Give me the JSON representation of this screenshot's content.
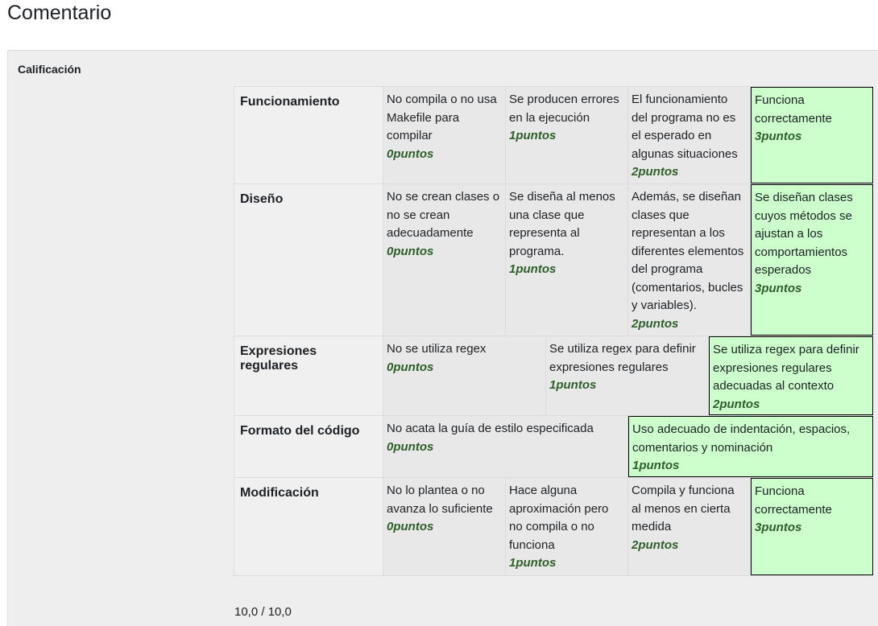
{
  "page": {
    "heading": "Comentario"
  },
  "grading": {
    "label": "Calificación",
    "total": "10,0 / 10,0"
  },
  "rubric": [
    {
      "criterion": "Funcionamiento",
      "height": 120,
      "levels": [
        {
          "definition": "No compila o no usa Makefile para compilar",
          "score": "0puntos",
          "checked": false
        },
        {
          "definition": "Se producen errores en la ejecución",
          "score": "1puntos",
          "checked": false
        },
        {
          "definition": "El funcionamiento del programa no es el esperado en algunas situaciones",
          "score": "2puntos",
          "checked": false
        },
        {
          "definition": "Funciona correctamente",
          "score": "3puntos",
          "checked": true
        }
      ]
    },
    {
      "criterion": "Diseño",
      "height": 188,
      "levels": [
        {
          "definition": "No se crean clases o no se crean adecuadamente",
          "score": "0puntos",
          "checked": false
        },
        {
          "definition": "Se diseña al menos una clase que representa al programa.",
          "score": "1puntos",
          "checked": false
        },
        {
          "definition": "Además, se diseñan clases que representan a los diferentes elementos del programa (comentarios, bucles y variables).",
          "score": "2puntos",
          "checked": false
        },
        {
          "definition": "Se diseñan clases cuyos métodos se ajustan a los comportamientos esperados",
          "score": "3puntos",
          "checked": true
        }
      ]
    },
    {
      "criterion": "Expresiones regulares",
      "height": 98,
      "levels": [
        {
          "definition": "No se utiliza regex",
          "score": "0puntos",
          "checked": false
        },
        {
          "definition": "Se utiliza regex para definir expresiones regulares",
          "score": "1puntos",
          "checked": false
        },
        {
          "definition": "Se utiliza regex para definir expresiones regulares adecuadas al contexto",
          "score": "2puntos",
          "checked": true
        }
      ]
    },
    {
      "criterion": "Formato del código",
      "height": 76,
      "levels": [
        {
          "definition": "No acata la guía de estilo especificada",
          "score": "0puntos",
          "checked": false
        },
        {
          "definition": "Uso adecuado de indentación, espacios, comentarios y nominación",
          "score": "1puntos",
          "checked": true
        }
      ]
    },
    {
      "criterion": "Modificación",
      "height": 121,
      "levels": [
        {
          "definition": "No lo plantea o no avanza lo suficiente",
          "score": "0puntos",
          "checked": false
        },
        {
          "definition": "Hace alguna aproximación pero no compila o no funciona",
          "score": "1puntos",
          "checked": false
        },
        {
          "definition": "Compila y funciona al menos en cierta medida",
          "score": "2puntos",
          "checked": false
        },
        {
          "definition": "Funciona correctamente",
          "score": "3puntos",
          "checked": true
        }
      ]
    }
  ],
  "colors": {
    "checked_bg": "#ccffcc",
    "score_text": "#2e5e29",
    "panel_bg": "#eeeeee"
  }
}
